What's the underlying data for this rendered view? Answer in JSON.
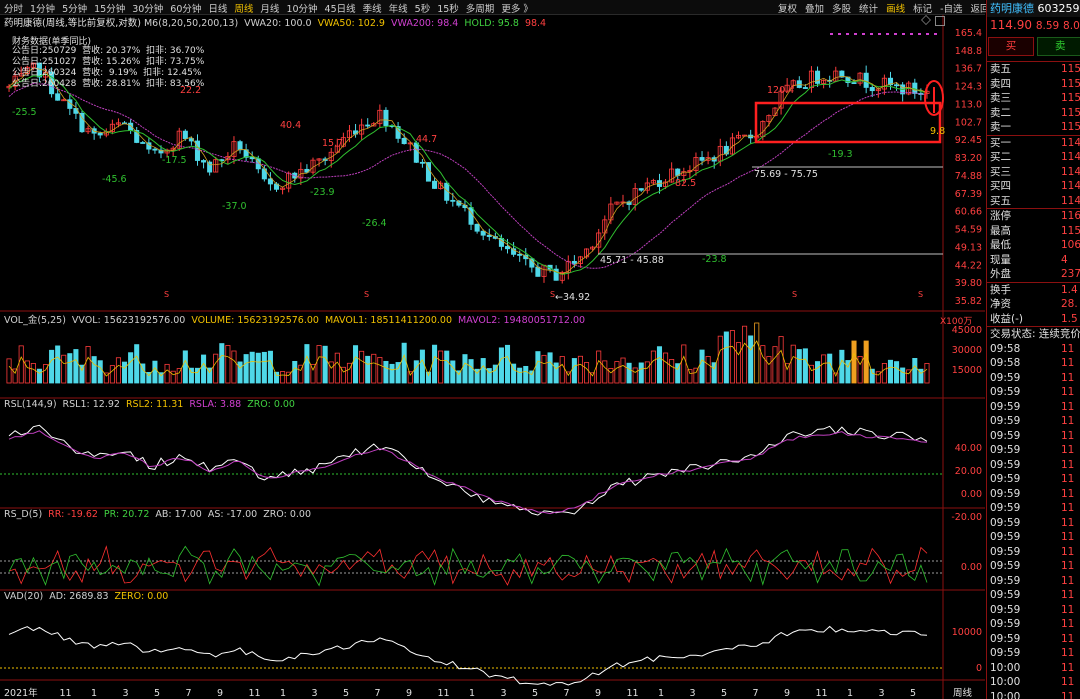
{
  "toolbar": {
    "tabs": [
      "分时",
      "1分钟",
      "5分钟",
      "15分钟",
      "30分钟",
      "60分钟",
      "日线",
      "周线",
      "月线",
      "10分钟",
      "45日线",
      "季线",
      "年线",
      "5秒",
      "15秒",
      "多周期",
      "更多 》"
    ],
    "active_tab": "周线",
    "right_tools": [
      "复权",
      "叠加",
      "多股",
      "统计",
      "画线",
      "标记",
      "-自选",
      "返回"
    ],
    "highlight_tool": "画线"
  },
  "price_panel": {
    "stock_title": "药明康德(周线,等比前复权,对数)",
    "indicators": [
      {
        "text": "M6(8,20,50,200,13)",
        "color": "#d0d0d0"
      },
      {
        "text": "VWA20: 100.0",
        "color": "#d0d0d0"
      },
      {
        "text": "VWA50: 102.9",
        "color": "#f0c000"
      },
      {
        "text": "VWA200: 98.4",
        "color": "#d040d0"
      },
      {
        "text": "HOLD: 95.8",
        "color": "#40d040"
      },
      {
        "text": "98.4",
        "color": "#ff4040"
      }
    ],
    "finance_title": "财务数据(单季同比)",
    "finance_rows": [
      "公告日:250729  营收: 20.37%  扣非: 36.70%",
      "公告日:251027  营收: 15.26%  扣非: 73.75%",
      "公告日:260324  营收:  9.19%  扣非: 12.45%",
      "公告日:260428  营收: 28.81%  扣非: 83.56%"
    ],
    "y_ticks": [
      "165.4",
      "148.8",
      "136.7",
      "124.3",
      "113.0",
      "102.7",
      "92.45",
      "83.20",
      "74.88",
      "67.39",
      "60.66",
      "54.59",
      "49.13",
      "44.22",
      "39.80",
      "35.82"
    ],
    "annotations": [
      "-25.5",
      "22.2",
      "-45.6",
      "-17.5",
      "-37.0",
      "40.4",
      "-23.9",
      "15.7",
      "-26.4",
      "44.7",
      "82.5",
      "-23.8",
      "120.4",
      "-19.3",
      "45.71 - 45.88",
      "75.69 - 75.75",
      "←34.92",
      "9.8"
    ],
    "cursor_price": "105"
  },
  "volume_panel": {
    "title_items": [
      {
        "text": "VOL_金(5,25)",
        "color": "#d0d0d0"
      },
      {
        "text": "VVOL: 15623192576.00",
        "color": "#d0d0d0"
      },
      {
        "text": "VOLUME: 15623192576.00",
        "color": "#f0c000"
      },
      {
        "text": "MAVOL1: 18511411200.00",
        "color": "#f0c000"
      },
      {
        "text": "MAVOL2: 19480051712.00",
        "color": "#d040d0"
      }
    ],
    "y_ticks": [
      "45000",
      "30000",
      "15000"
    ],
    "unit": "X100万"
  },
  "rsl_panel": {
    "title_items": [
      {
        "text": "RSL(144,9)",
        "color": "#d0d0d0"
      },
      {
        "text": "RSL1: 12.92",
        "color": "#d0d0d0"
      },
      {
        "text": "RSL2: 11.31",
        "color": "#f0c000"
      },
      {
        "text": "RSLA: 3.88",
        "color": "#d040d0"
      },
      {
        "text": "ZRO: 0.00",
        "color": "#40d040"
      }
    ],
    "y_ticks": [
      "40.00",
      "20.00",
      "0.00",
      "-20.00"
    ]
  },
  "rsd_panel": {
    "title_items": [
      {
        "text": "RS_D(5)",
        "color": "#d0d0d0"
      },
      {
        "text": "RR: -19.62",
        "color": "#ff4040"
      },
      {
        "text": "PR: 20.72",
        "color": "#40d040"
      },
      {
        "text": "AB: 17.00",
        "color": "#d0d0d0"
      },
      {
        "text": "AS: -17.00",
        "color": "#d0d0d0"
      },
      {
        "text": "ZRO: 0.00",
        "color": "#d0d0d0"
      }
    ],
    "y_ticks": [
      "0.00"
    ]
  },
  "vad_panel": {
    "title_items": [
      {
        "text": "VAD(20)",
        "color": "#d0d0d0"
      },
      {
        "text": "AD: 2689.83",
        "color": "#d0d0d0"
      },
      {
        "text": "ZERO: 0.00",
        "color": "#f0c000"
      }
    ],
    "y_ticks": [
      "10000",
      "0"
    ]
  },
  "x_axis": {
    "labels": [
      "2021年",
      "11",
      "1",
      "3",
      "5",
      "7",
      "9",
      "11",
      "1",
      "3",
      "5",
      "7",
      "9",
      "11",
      "1",
      "3",
      "5",
      "7",
      "9",
      "11",
      "1",
      "3",
      "5",
      "7",
      "9",
      "11",
      "1",
      "3",
      "5"
    ],
    "period_label": "周线"
  },
  "right_panel": {
    "name": "药明康德",
    "code": "603259",
    "price": "114.90",
    "change": "8.59",
    "change_pct": "8.08",
    "buy_label": "买",
    "sell_label": "卖",
    "ask_rows": [
      {
        "label": "卖五",
        "value": "115"
      },
      {
        "label": "卖四",
        "value": "115"
      },
      {
        "label": "卖三",
        "value": "115"
      },
      {
        "label": "卖二",
        "value": "115"
      },
      {
        "label": "卖一",
        "value": "115"
      }
    ],
    "bid_rows": [
      {
        "label": "买一",
        "value": "114"
      },
      {
        "label": "买二",
        "value": "114"
      },
      {
        "label": "买三",
        "value": "114"
      },
      {
        "label": "买四",
        "value": "114"
      },
      {
        "label": "买五",
        "value": "114"
      }
    ],
    "stat_rows": [
      {
        "label": "涨停",
        "value": "116"
      },
      {
        "label": "最高",
        "value": "115"
      },
      {
        "label": "最低",
        "value": "106"
      },
      {
        "label": "现量",
        "value": "4"
      },
      {
        "label": "外盘",
        "value": "2372"
      }
    ],
    "stat_rows2": [
      {
        "label": "换手",
        "value": "1.4"
      },
      {
        "label": "净资",
        "value": "28."
      },
      {
        "label": "收益(-)",
        "value": "1.5"
      }
    ],
    "trade_status": "交易状态: 连续竞价",
    "ticks": [
      {
        "time": "09:58",
        "value": "11"
      },
      {
        "time": "09:58",
        "value": "11"
      },
      {
        "time": "09:59",
        "value": "11"
      },
      {
        "time": "09:59",
        "value": "11"
      },
      {
        "time": "09:59",
        "value": "11"
      },
      {
        "time": "09:59",
        "value": "11"
      },
      {
        "time": "09:59",
        "value": "11"
      },
      {
        "time": "09:59",
        "value": "11"
      },
      {
        "time": "09:59",
        "value": "11"
      },
      {
        "time": "09:59",
        "value": "11"
      },
      {
        "time": "09:59",
        "value": "11"
      },
      {
        "time": "09:59",
        "value": "11"
      },
      {
        "time": "09:59",
        "value": "11"
      },
      {
        "time": "09:59",
        "value": "11"
      },
      {
        "time": "09:59",
        "value": "11"
      },
      {
        "time": "09:59",
        "value": "11"
      },
      {
        "time": "09:59",
        "value": "11"
      },
      {
        "time": "09:59",
        "value": "11"
      },
      {
        "time": "09:59",
        "value": "11"
      },
      {
        "time": "09:59",
        "value": "11"
      },
      {
        "time": "09:59",
        "value": "11"
      },
      {
        "time": "09:59",
        "value": "11"
      },
      {
        "time": "10:00",
        "value": "11"
      },
      {
        "time": "10:00",
        "value": "11"
      },
      {
        "time": "10:00",
        "value": "11"
      },
      {
        "time": "10:00",
        "value": "11"
      }
    ]
  },
  "colors": {
    "up": "#ff3c3c",
    "down": "#4fd8e8",
    "grid": "#8b1010",
    "ma_white": "#e8e8e8",
    "ma_magenta": "#c040c0",
    "ma_green": "#30c030",
    "highlight_box": "#ff2020"
  }
}
